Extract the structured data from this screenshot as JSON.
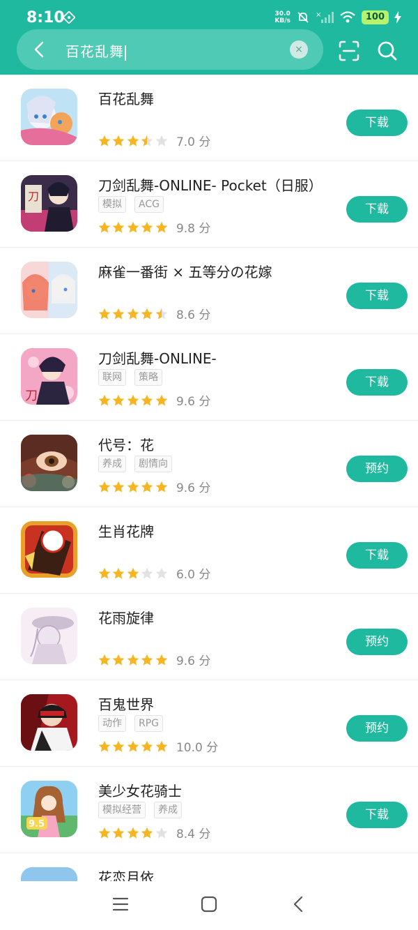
{
  "status_bar": {
    "time": "8:10",
    "net_speed_value": "30.0",
    "net_speed_unit": "KB/s",
    "battery": "100"
  },
  "search": {
    "query": "百花乱舞",
    "clear_icon": "×"
  },
  "apps": [
    {
      "title": "百花乱舞",
      "tags": [],
      "stars": 3.5,
      "score": "7.0 分",
      "action": "下载"
    },
    {
      "title": "刀剑乱舞-ONLINE- Pocket（日服）",
      "tags": [
        "模拟",
        "ACG"
      ],
      "stars": 5,
      "score": "9.8 分",
      "action": "下载"
    },
    {
      "title": "麻雀一番街 × 五等分の花嫁",
      "tags": [],
      "stars": 4.5,
      "score": "8.6 分",
      "action": "下载"
    },
    {
      "title": "刀剑乱舞-ONLINE-",
      "tags": [
        "联网",
        "策略"
      ],
      "stars": 5,
      "score": "9.6 分",
      "action": "下载"
    },
    {
      "title": "代号：花",
      "tags": [
        "养成",
        "剧情向"
      ],
      "stars": 5,
      "score": "9.6 分",
      "action": "预约"
    },
    {
      "title": "生肖花牌",
      "tags": [],
      "stars": 3,
      "score": "6.0 分",
      "action": "下载"
    },
    {
      "title": "花雨旋律",
      "tags": [],
      "stars": 5,
      "score": "9.6 分",
      "action": "预约"
    },
    {
      "title": "百鬼世界",
      "tags": [
        "动作",
        "RPG"
      ],
      "stars": 5,
      "score": "10.0 分",
      "action": "预约"
    },
    {
      "title": "美少女花骑士",
      "tags": [
        "模拟经营",
        "养成"
      ],
      "stars": 4,
      "score": "8.4 分",
      "action": "下载"
    },
    {
      "title": "花恋月依",
      "tags": [],
      "stars": 0,
      "score": "",
      "action": ""
    }
  ],
  "colors": {
    "accent": "#1fb9a0",
    "star_on": "#f7b521",
    "star_off": "#e2e2e2"
  },
  "icons": {
    "back": "back-arrow-icon",
    "clear": "clear-icon",
    "scan": "scan-icon",
    "search": "search-icon",
    "nav_menu": "menu-icon",
    "nav_home": "home-icon",
    "nav_back": "nav-back-icon"
  }
}
